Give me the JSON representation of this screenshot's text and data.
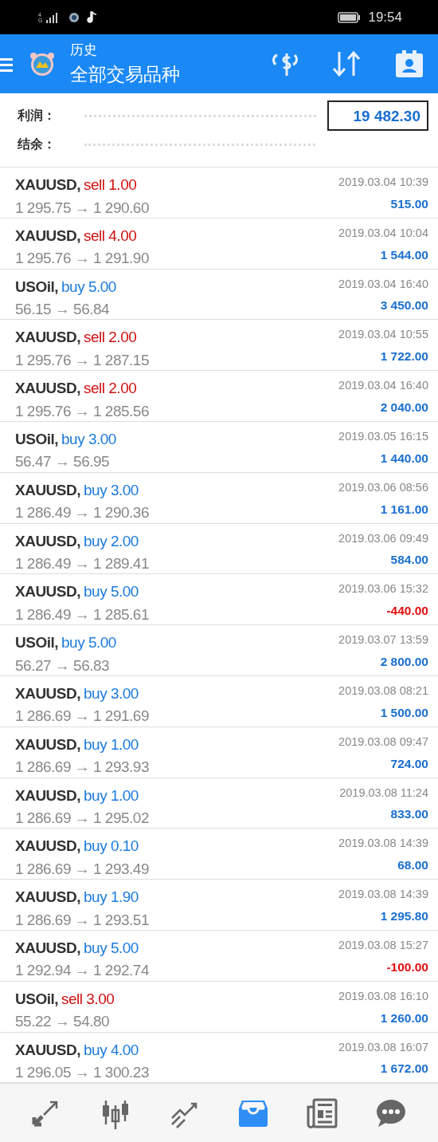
{
  "status_bar": {
    "network": "4G",
    "time": "19:54"
  },
  "header": {
    "title": "历史",
    "subtitle": "全部交易品种"
  },
  "summary": [
    {
      "label": "利润：",
      "value": "19 482.30"
    },
    {
      "label": "结余："
    }
  ],
  "deals": [
    {
      "symbol": "XAUUSD,",
      "order": "sell 1.00",
      "kind": "sell",
      "prices": "1 295.75 → 1 290.60",
      "time": "2019.03.04 10:39",
      "profit": "515.00",
      "loss": false
    },
    {
      "symbol": "XAUUSD,",
      "order": "sell 4.00",
      "kind": "sell",
      "prices": "1 295.76 → 1 291.90",
      "time": "2019.03.04 10:04",
      "profit": "1 544.00",
      "loss": false
    },
    {
      "symbol": "USOil,",
      "order": "buy 5.00",
      "kind": "buy",
      "prices": "56.15 → 56.84",
      "time": "2019.03.04 16:40",
      "profit": "3 450.00",
      "loss": false
    },
    {
      "symbol": "XAUUSD,",
      "order": "sell 2.00",
      "kind": "sell",
      "prices": "1 295.76 → 1 287.15",
      "time": "2019.03.04 10:55",
      "profit": "1 722.00",
      "loss": false
    },
    {
      "symbol": "XAUUSD,",
      "order": "sell 2.00",
      "kind": "sell",
      "prices": "1 295.76 → 1 285.56",
      "time": "2019.03.04 16:40",
      "profit": "2 040.00",
      "loss": false
    },
    {
      "symbol": "USOil,",
      "order": "buy 3.00",
      "kind": "buy",
      "prices": "56.47 → 56.95",
      "time": "2019.03.05 16:15",
      "profit": "1 440.00",
      "loss": false
    },
    {
      "symbol": "XAUUSD,",
      "order": "buy 3.00",
      "kind": "buy",
      "prices": "1 286.49 → 1 290.36",
      "time": "2019.03.06 08:56",
      "profit": "1 161.00",
      "loss": false
    },
    {
      "symbol": "XAUUSD,",
      "order": "buy 2.00",
      "kind": "buy",
      "prices": "1 286.49 → 1 289.41",
      "time": "2019.03.06 09:49",
      "profit": "584.00",
      "loss": false
    },
    {
      "symbol": "XAUUSD,",
      "order": "buy 5.00",
      "kind": "buy",
      "prices": "1 286.49 → 1 285.61",
      "time": "2019.03.06 15:32",
      "profit": "-440.00",
      "loss": true
    },
    {
      "symbol": "USOil,",
      "order": "buy 5.00",
      "kind": "buy",
      "prices": "56.27 → 56.83",
      "time": "2019.03.07 13:59",
      "profit": "2 800.00",
      "loss": false
    },
    {
      "symbol": "XAUUSD,",
      "order": "buy 3.00",
      "kind": "buy",
      "prices": "1 286.69 → 1 291.69",
      "time": "2019.03.08 08:21",
      "profit": "1 500.00",
      "loss": false
    },
    {
      "symbol": "XAUUSD,",
      "order": "buy 1.00",
      "kind": "buy",
      "prices": "1 286.69 → 1 293.93",
      "time": "2019.03.08 09:47",
      "profit": "724.00",
      "loss": false
    },
    {
      "symbol": "XAUUSD,",
      "order": "buy 1.00",
      "kind": "buy",
      "prices": "1 286.69 → 1 295.02",
      "time": "2019.03.08 11:24",
      "profit": "833.00",
      "loss": false
    },
    {
      "symbol": "XAUUSD,",
      "order": "buy 0.10",
      "kind": "buy",
      "prices": "1 286.69 → 1 293.49",
      "time": "2019.03.08 14:39",
      "profit": "68.00",
      "loss": false
    },
    {
      "symbol": "XAUUSD,",
      "order": "buy 1.90",
      "kind": "buy",
      "prices": "1 286.69 → 1 293.51",
      "time": "2019.03.08 14:39",
      "profit": "1 295.80",
      "loss": false
    },
    {
      "symbol": "XAUUSD,",
      "order": "buy 5.00",
      "kind": "buy",
      "prices": "1 292.94 → 1 292.74",
      "time": "2019.03.08 15:27",
      "profit": "-100.00",
      "loss": true
    },
    {
      "symbol": "USOil,",
      "order": "sell 3.00",
      "kind": "sell",
      "prices": "55.22 → 54.80",
      "time": "2019.03.08 16:10",
      "profit": "1 260.00",
      "loss": false
    },
    {
      "symbol": "XAUUSD,",
      "order": "buy 4.00",
      "kind": "buy",
      "prices": "1 296.05 → 1 300.23",
      "time": "2019.03.08 16:07",
      "profit": "1 672.00",
      "loss": false
    }
  ],
  "bottom_nav": [
    {
      "kind": "quotes",
      "selected": false
    },
    {
      "kind": "chart",
      "selected": false
    },
    {
      "kind": "trade",
      "selected": false
    },
    {
      "kind": "history",
      "selected": true
    },
    {
      "kind": "news",
      "selected": false
    },
    {
      "kind": "chat",
      "selected": false
    }
  ]
}
